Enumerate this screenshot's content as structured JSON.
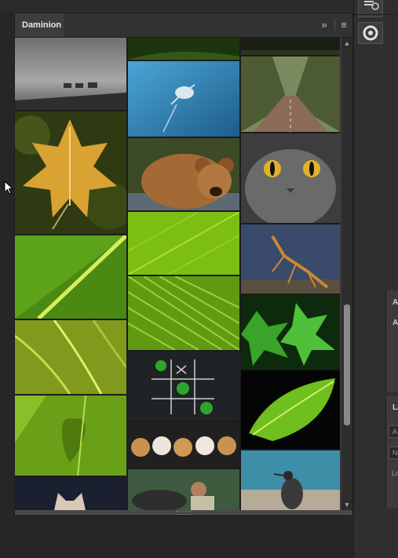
{
  "panel": {
    "tab_label": "Daminion",
    "fast_forward_glyph": "»",
    "menu_glyph": "≡"
  },
  "scrollbar": {
    "up_glyph": "▲",
    "down_glyph": "▼"
  },
  "right_panel": {
    "labels": [
      "A",
      "A",
      "La"
    ],
    "fields": [
      "A",
      "N",
      "Lo"
    ]
  },
  "thumbnails": [
    {
      "name": "thumb-elephants-mist"
    },
    {
      "name": "thumb-autumn-maple-leaf"
    },
    {
      "name": "thumb-green-leaf-stripe"
    },
    {
      "name": "thumb-fern-fronds"
    },
    {
      "name": "thumb-heart-leaf"
    },
    {
      "name": "thumb-dog-head"
    },
    {
      "name": "thumb-dark-green-top"
    },
    {
      "name": "thumb-butterfly-blue"
    },
    {
      "name": "thumb-brown-bear"
    },
    {
      "name": "thumb-green-leaf-texture"
    },
    {
      "name": "thumb-palm-leaf-rays"
    },
    {
      "name": "thumb-clover-tic-tac-toe"
    },
    {
      "name": "thumb-five-pomeranians"
    },
    {
      "name": "thumb-man-with-buffalo"
    },
    {
      "name": "thumb-dark-forest-top"
    },
    {
      "name": "thumb-tree-lined-road"
    },
    {
      "name": "thumb-gray-cat"
    },
    {
      "name": "thumb-praying-mantis"
    },
    {
      "name": "thumb-green-maple-leaves"
    },
    {
      "name": "thumb-single-green-leaf"
    },
    {
      "name": "thumb-heron-lake"
    }
  ]
}
